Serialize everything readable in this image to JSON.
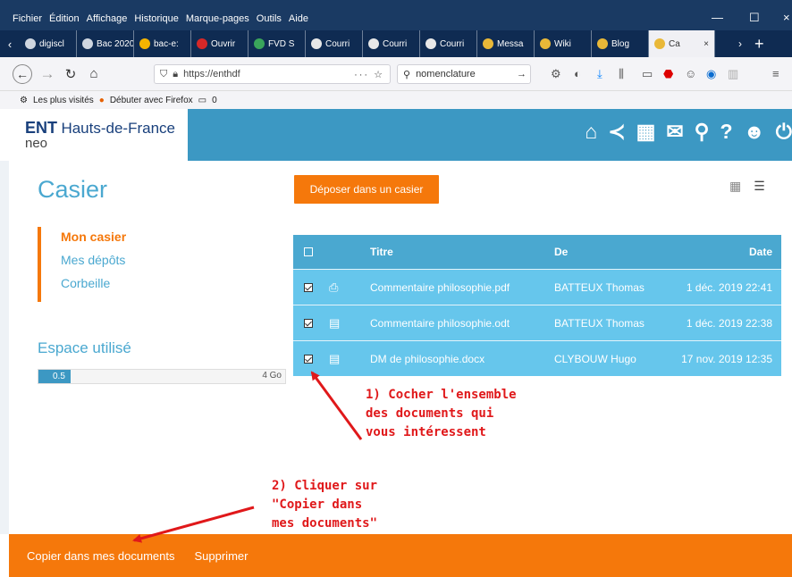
{
  "browser": {
    "menu": [
      "Fichier",
      "Édition",
      "Affichage",
      "Historique",
      "Marque-pages",
      "Outils",
      "Aide"
    ],
    "tabs": [
      {
        "label": "digiscl",
        "color": "#cfd6e0"
      },
      {
        "label": "Bac 2020 :",
        "color": "#cfd6e0"
      },
      {
        "label": "bac-e:",
        "color": "#f5b400"
      },
      {
        "label": "Ouvrir",
        "color": "#d62828"
      },
      {
        "label": "FVD S",
        "color": "#3aa55b"
      },
      {
        "label": "Courri",
        "color": "#e8e8e8"
      },
      {
        "label": "Courri",
        "color": "#e8e8e8"
      },
      {
        "label": "Courri",
        "color": "#e8e8e8"
      },
      {
        "label": "Messa",
        "color": "#e9b838"
      },
      {
        "label": "Wiki",
        "color": "#e9b838"
      },
      {
        "label": "Blog",
        "color": "#e9b838"
      },
      {
        "label": "Ca",
        "color": "#e9b838",
        "active": true
      }
    ],
    "url": "https://enthdf",
    "search": "nomenclature",
    "bookmarks": [
      "Les plus visités",
      "Débuter avec Firefox",
      "0"
    ]
  },
  "ent": {
    "logo_ent": "ENT",
    "logo_region": "Hauts-de-France",
    "logo_neo": "neo"
  },
  "page": {
    "title": "Casier",
    "deposit_button": "Déposer dans un casier",
    "nav": {
      "mon_casier": "Mon casier",
      "mes_depots": "Mes dépôts",
      "corbeille": "Corbeille"
    },
    "storage": {
      "title": "Espace utilisé",
      "used": "0.5",
      "max": "4 Go",
      "fraction": 0.13
    }
  },
  "table": {
    "headers": {
      "title": "Titre",
      "from": "De",
      "date": "Date"
    },
    "rows": [
      {
        "title": "Commentaire philosophie.pdf",
        "from": "BATTEUX Thomas",
        "date": "1 déc. 2019 22:41",
        "icon": "pdf"
      },
      {
        "title": "Commentaire philosophie.odt",
        "from": "BATTEUX Thomas",
        "date": "1 déc. 2019 22:38",
        "icon": "doc"
      },
      {
        "title": "DM de philosophie.docx",
        "from": "CLYBOUW Hugo",
        "date": "17 nov. 2019 12:35",
        "icon": "doc"
      }
    ]
  },
  "annotations": {
    "note1": [
      "1) Cocher l'ensemble",
      "des documents qui",
      "vous intéressent"
    ],
    "note2": [
      "2) Cliquer sur",
      "\"Copier dans",
      "mes documents\""
    ]
  },
  "actions": {
    "copy": "Copier dans mes documents",
    "delete": "Supprimer"
  },
  "colors": {
    "accent": "#f5780b",
    "brand": "#3c98c3",
    "row": "#66c6ec",
    "annotation": "#e0181a"
  }
}
